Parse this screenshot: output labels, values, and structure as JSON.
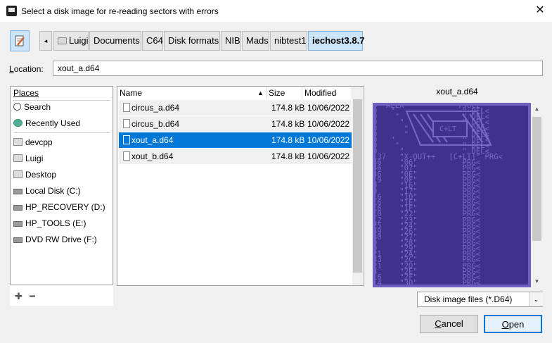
{
  "window": {
    "title": "Select a disk image for re-reading sectors with errors",
    "close_glyph": "✕"
  },
  "pathbar": {
    "edit_icon": "pencil-edit-icon",
    "back_glyph": "◂",
    "items": [
      "Luigi",
      "Documents",
      "C64",
      "Disk formats",
      "NIB",
      "Mads",
      "nibtest1",
      "iechost3.8.7"
    ]
  },
  "location": {
    "label_prefix": "",
    "label_hotkey": "L",
    "label_rest": "ocation:",
    "value": "xout_a.d64"
  },
  "places": {
    "header": "Places",
    "items": [
      {
        "label": "Search",
        "icon": "search-icon"
      },
      {
        "label": "Recently Used",
        "icon": "recent-icon"
      },
      {
        "label": "devcpp",
        "icon": "folder-icon"
      },
      {
        "label": "Luigi",
        "icon": "folder-icon"
      },
      {
        "label": "Desktop",
        "icon": "folder-icon"
      },
      {
        "label": "Local Disk (C:)",
        "icon": "drive-icon"
      },
      {
        "label": "HP_RECOVERY (D:)",
        "icon": "drive-icon"
      },
      {
        "label": "HP_TOOLS (E:)",
        "icon": "drive-icon"
      },
      {
        "label": "DVD RW Drive (F:)",
        "icon": "optical-drive-icon"
      }
    ],
    "add_glyph": "✚",
    "remove_glyph": "━"
  },
  "files": {
    "columns": {
      "name": "Name",
      "size": "Size",
      "modified": "Modified",
      "sort_glyph": "▲"
    },
    "rows": [
      {
        "name": "circus_a.d64",
        "size": "174.8 kB",
        "modified": "10/06/2022"
      },
      {
        "name": "circus_b.d64",
        "size": "174.8 kB",
        "modified": "10/06/2022"
      },
      {
        "name": "xout_a.d64",
        "size": "174.8 kB",
        "modified": "10/06/2022"
      },
      {
        "name": "xout_b.d64",
        "size": "174.8 kB",
        "modified": "10/06/2022"
      }
    ],
    "selected_index": 2
  },
  "preview": {
    "filename": "xout_a.d64",
    "listing": "0 \"ALEX          \" 796C2\n0   \"               \" DEL<\n0    \"              \" DEL<\n0     \"             \" DEL<\n0      \"            \" DEL<\n0      \"            \" DEL<\n0   \"               \" DEL<\n0    \"              \" DEL<\n0     \"             \" DEL<\n137   \"X-OUT++   [C+LT]\" PRG<\n46    \"06\"          PRG<\n46    \"07\"          PRG<\n46    \"0E\"          PRG<\n19    \"0F\"          PRG<\n9     \"16\"          PRG<\n9     \"17\"          PRG<\n16    \"10\"          PRG<\n16    \"1E\"          PRG<\n16    \"1F\"          PRG<\n10    \"22\"          PRG<\n12    \"23\"          PRG<\n25    \"24\"          PRG<\n49    \"26\"          PRG<\n30    \"27\"          PRG<\n9     \"28\"          PRG<\n9     \"29\"          PRG<\n21    \"2A\"          PRG<\n33    \"2C\"          PRG<\n21    \"2D\"          PRG<\n4     \"2E\"          PRG<\n16    \"2F\"          PRG<\n14    \"30\"          PRG<",
    "logo_text": "C+LT",
    "scroll_up_glyph": "▲",
    "scroll_down_glyph": "▼"
  },
  "filter": {
    "value": "Disk image files (*.D64)",
    "arrow_glyph": "⌄"
  },
  "buttons": {
    "cancel_hotkey": "C",
    "cancel_rest": "ancel",
    "open_hotkey": "O",
    "open_rest": "pen"
  },
  "colors": {
    "selection": "#0078d7",
    "c64_background": "#40318d",
    "c64_text": "#7869c4"
  }
}
